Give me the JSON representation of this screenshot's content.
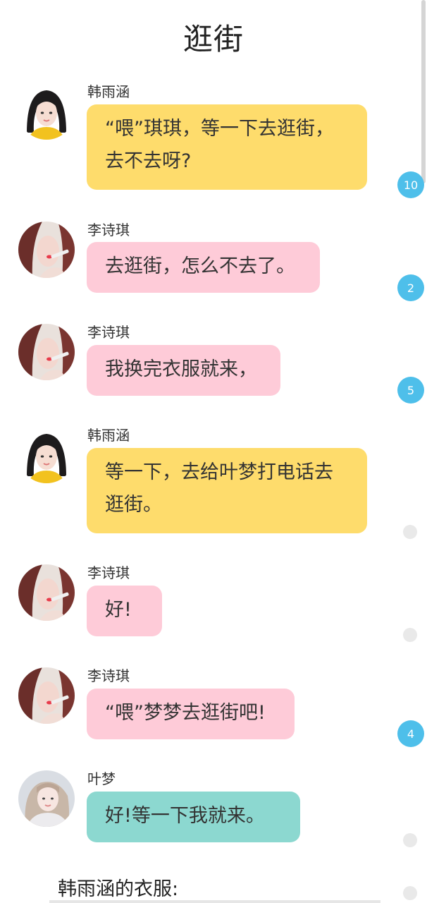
{
  "header": {
    "title": "逛街"
  },
  "messages": [
    {
      "sender": "韩雨涵",
      "text_lines": [
        "“喂”琪琪，等一下去逛街，",
        "去不去呀?"
      ],
      "color": "#fedc6c",
      "avatar": "girl-yellow-shirt",
      "badge": "10"
    },
    {
      "sender": "李诗琪",
      "text_lines": [
        "去逛街，怎么不去了。"
      ],
      "color": "#fecbd8",
      "avatar": "girl-red-lips",
      "badge": "2"
    },
    {
      "sender": "李诗琪",
      "text_lines": [
        "我换完衣服就来，"
      ],
      "color": "#fecbd8",
      "avatar": "girl-red-lips",
      "badge": "5"
    },
    {
      "sender": "韩雨涵",
      "text_lines": [
        "等一下，去给叶梦打电话去",
        "逛街。"
      ],
      "color": "#fedc6c",
      "avatar": "girl-yellow-shirt",
      "badge": ""
    },
    {
      "sender": "李诗琪",
      "text_lines": [
        "好!"
      ],
      "color": "#fecbd8",
      "avatar": "girl-red-lips",
      "badge": ""
    },
    {
      "sender": "李诗琪",
      "text_lines": [
        "“喂”梦梦去逛街吧!"
      ],
      "color": "#fecbd8",
      "avatar": "girl-red-lips",
      "badge": "4"
    },
    {
      "sender": "叶梦",
      "text_lines": [
        "好!等一下我就来。"
      ],
      "color": "#8cd8d0",
      "avatar": "girl-pale-sweater",
      "badge": ""
    }
  ],
  "section": {
    "title": "韩雨涵的衣服:"
  }
}
